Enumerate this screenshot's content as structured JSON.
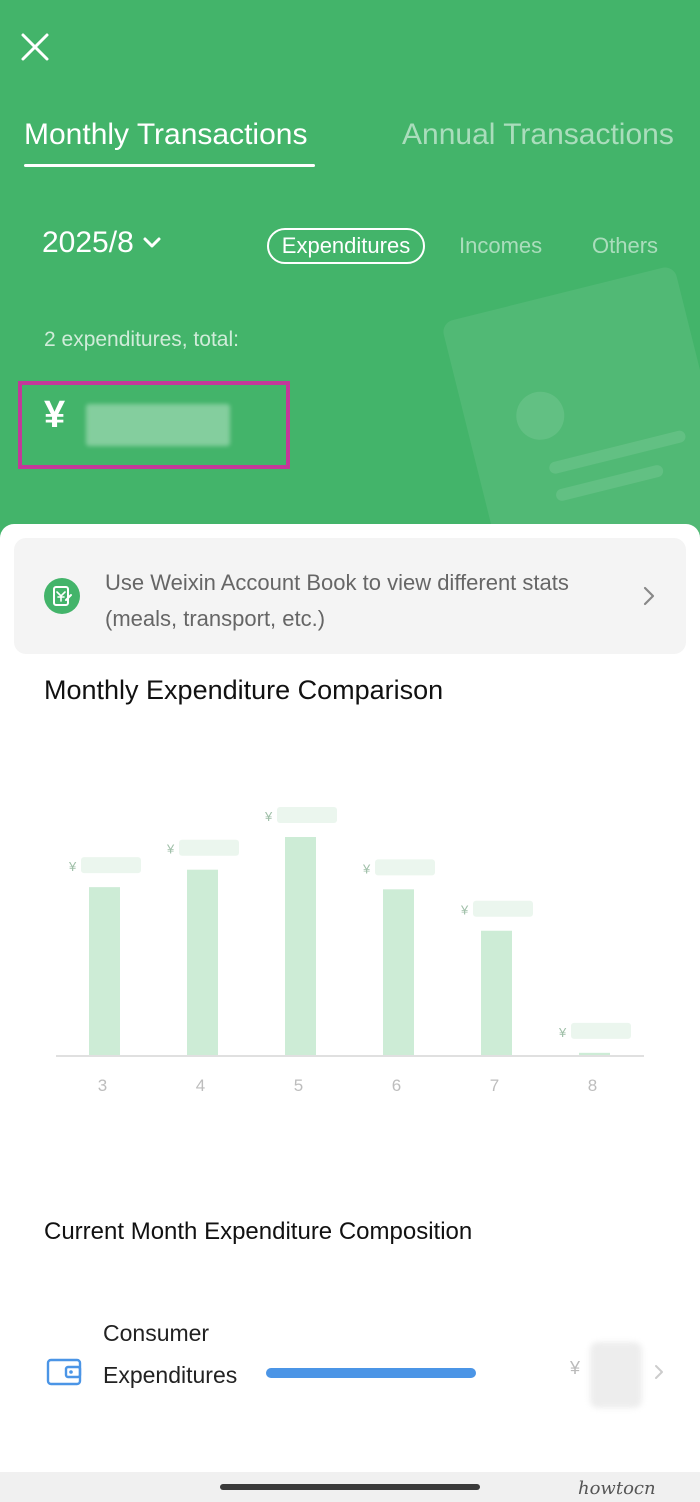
{
  "header": {
    "tabs": [
      {
        "label": "Monthly Transactions",
        "active": true
      },
      {
        "label": "Annual Transactions",
        "active": false
      }
    ],
    "month": "2025/8",
    "filters": [
      {
        "label": "Expenditures",
        "active": true
      },
      {
        "label": "Incomes",
        "active": false
      },
      {
        "label": "Others",
        "active": false
      }
    ],
    "summary": "2 expenditures, total:",
    "currency": "¥"
  },
  "promo": {
    "text": "Use Weixin Account Book to view different stats (meals, transport, etc.)"
  },
  "sections": {
    "comparison_title": "Monthly Expenditure Comparison",
    "composition_title": "Current Month Expenditure Composition"
  },
  "chart_data": {
    "type": "bar",
    "categories": [
      "3",
      "4",
      "5",
      "6",
      "7",
      "8"
    ],
    "values": [
      0.77,
      0.85,
      1.0,
      0.76,
      0.57,
      0.01
    ],
    "value_labels": [
      "¥",
      "¥",
      "¥",
      "¥",
      "¥",
      "¥"
    ],
    "ylim": [
      0,
      1
    ],
    "grid": false,
    "colors": {
      "bar": "#cdecd6",
      "axis": "#e0e0e0",
      "tick": "#bdbdbd",
      "label": "#9fbfa8"
    }
  },
  "composition": {
    "items": [
      {
        "label": "Consumer Expendi­tur­es",
        "currency": "¥",
        "fraction": 1.0
      }
    ]
  },
  "colors": {
    "brand_green": "#43b46a",
    "highlight_box": "#c3399a",
    "progress_blue": "#4b95e6"
  },
  "watermark": "howtocn"
}
